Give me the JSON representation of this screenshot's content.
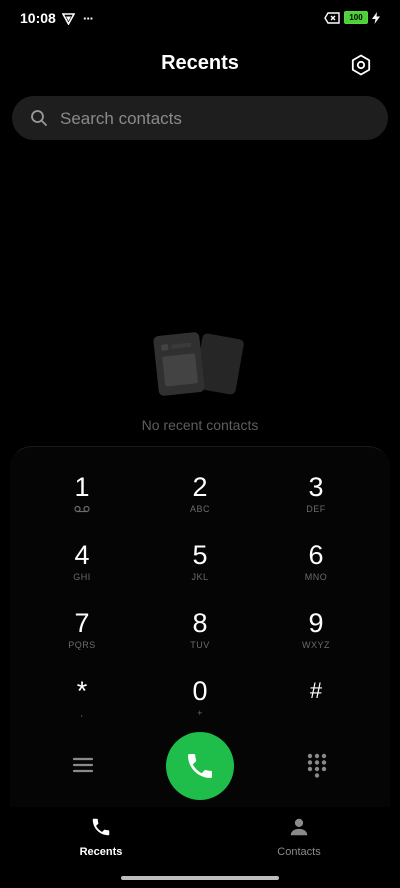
{
  "status_bar": {
    "time": "10:08",
    "more": "···",
    "battery_level": "100"
  },
  "header": {
    "title": "Recents"
  },
  "search": {
    "placeholder": "Search contacts"
  },
  "empty_state": {
    "message": "No recent contacts"
  },
  "dialpad": {
    "keys": [
      {
        "digit": "1",
        "letters": ""
      },
      {
        "digit": "2",
        "letters": "ABC"
      },
      {
        "digit": "3",
        "letters": "DEF"
      },
      {
        "digit": "4",
        "letters": "GHI"
      },
      {
        "digit": "5",
        "letters": "JKL"
      },
      {
        "digit": "6",
        "letters": "MNO"
      },
      {
        "digit": "7",
        "letters": "PQRS"
      },
      {
        "digit": "8",
        "letters": "TUV"
      },
      {
        "digit": "9",
        "letters": "WXYZ"
      },
      {
        "digit": "*",
        "letters": ","
      },
      {
        "digit": "0",
        "letters": "+"
      },
      {
        "digit": "#",
        "letters": ""
      }
    ]
  },
  "bottom_nav": {
    "recents": "Recents",
    "contacts": "Contacts"
  },
  "colors": {
    "background": "#000000",
    "call_green": "#1fbd4a",
    "battery_green": "#4cd137",
    "search_bg": "#1e1e1e",
    "muted_text": "#6b6b6b"
  },
  "icons": {
    "settings": "hexagon-gear-icon",
    "search": "magnifier-icon",
    "menu": "hamburger-icon",
    "call": "phone-handset-icon",
    "keypad": "dialpad-grid-icon",
    "recents_tab": "phone-icon",
    "contacts_tab": "person-icon"
  }
}
